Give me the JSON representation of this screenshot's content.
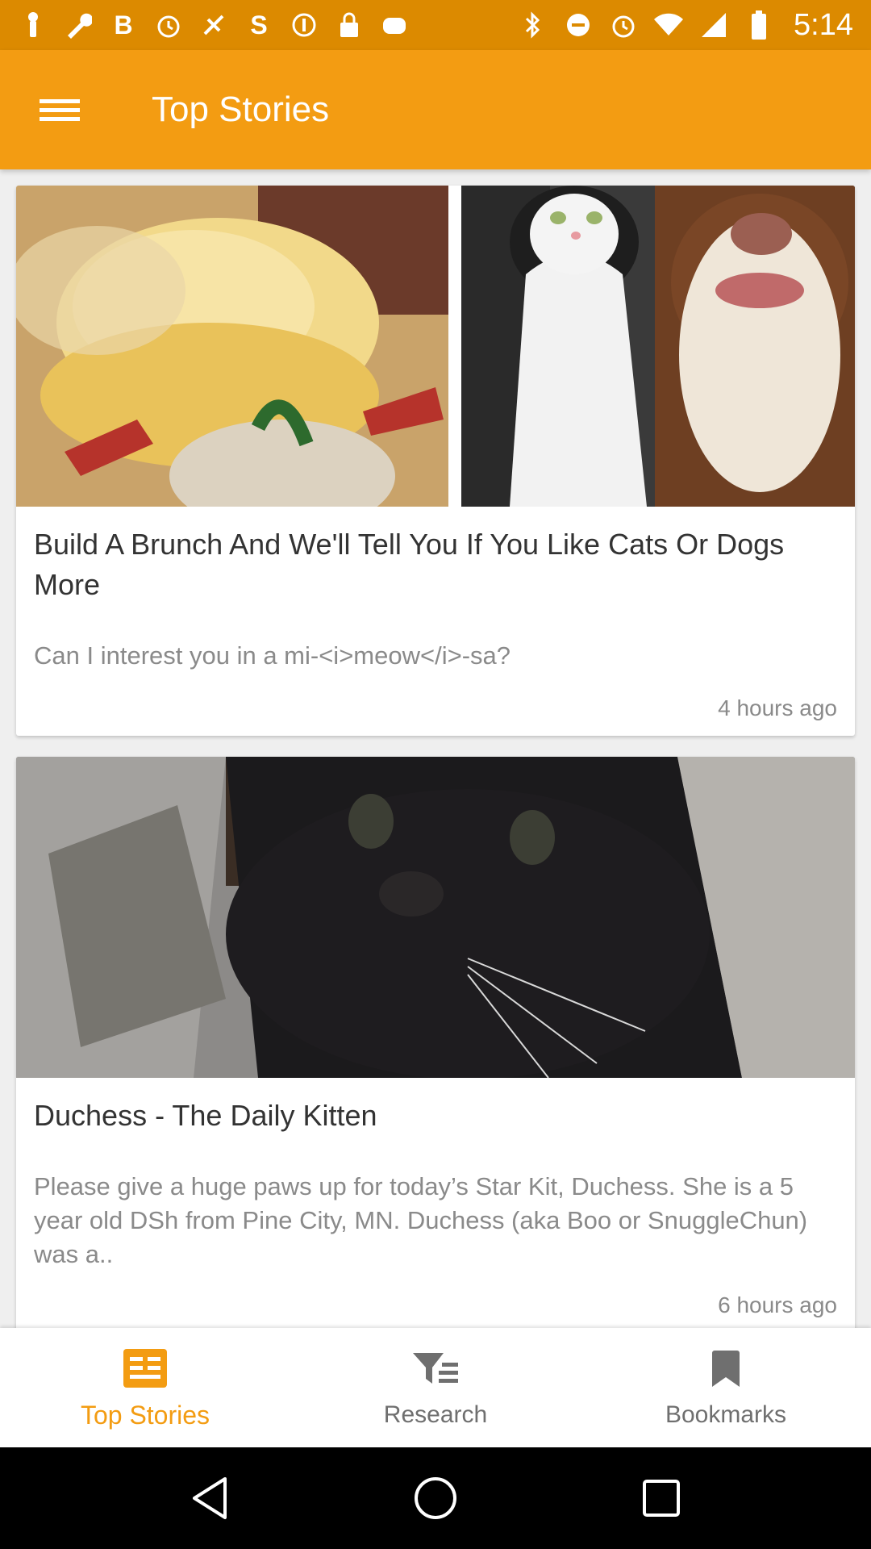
{
  "status_bar": {
    "time": "5:14",
    "left_icons": [
      "notification-icon",
      "wrench-icon",
      "bold-b-icon",
      "alarm-icon",
      "fake-gps-icon",
      "s-app-icon",
      "coin-icon",
      "lock-icon",
      "game-icon"
    ],
    "right_icons": [
      "bluetooth-icon",
      "do-not-disturb-icon",
      "alarm-icon",
      "wifi-icon",
      "signal-icon",
      "battery-icon"
    ]
  },
  "app_bar": {
    "title": "Top Stories",
    "color": "#f39c12"
  },
  "feed": {
    "cards": [
      {
        "title": "Build A Brunch And We'll Tell You If You Like Cats Or Dogs More",
        "subtitle": "Can I interest you in a mi-<i>meow</i>-sa?",
        "time": "4 hours ago"
      },
      {
        "title": "Duchess - The Daily Kitten",
        "subtitle": "Please give a huge paws up for today’s Star Kit, Duchess. She is a 5 year old DSh from Pine City, MN. Duchess (aka Boo or SnuggleChun) was a..",
        "time": "6 hours ago"
      }
    ]
  },
  "bottom_nav": {
    "items": [
      {
        "label": "Top Stories",
        "icon": "newspaper-icon",
        "active": true
      },
      {
        "label": "Research",
        "icon": "filter-list-icon",
        "active": false
      },
      {
        "label": "Bookmarks",
        "icon": "bookmark-icon",
        "active": false
      }
    ],
    "active_color": "#f39c12"
  },
  "system_nav": {
    "buttons": [
      "back-icon",
      "home-icon",
      "recents-icon"
    ]
  }
}
